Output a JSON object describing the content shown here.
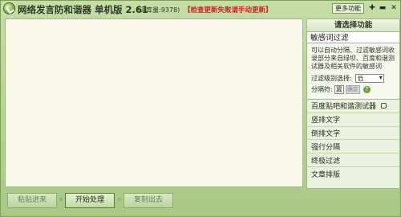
{
  "window": {
    "title": "网络发言防和谐器 单机版 2.61",
    "word_count": "(词库量:9378)",
    "update_link": "【检查更新失败请手动更新】",
    "more_button": "更多功能",
    "controls": {
      "pin": "✚",
      "minimize": "▬",
      "close": "✕"
    }
  },
  "editor": {
    "value": ""
  },
  "panel": {
    "header": "请选择功能",
    "selected": "敏感词过滤",
    "description": "可以自动分隔、过滤敏感词收录部分来自绿坝、百度和谐测试器及相关软件的敏感词",
    "level_label": "过滤级别选择:",
    "level_value": "低",
    "separator_label": "分隔符:",
    "separator_value": "冀",
    "confirm_label": "确定",
    "help_glyph": "?",
    "items": [
      {
        "label": "百度贴吧和谐测试器"
      },
      {
        "label": "竖排文字"
      },
      {
        "label": "倒排文字"
      },
      {
        "label": "强行分隔"
      },
      {
        "label": "终极过滤"
      },
      {
        "label": "文章排版"
      }
    ]
  },
  "buttons": {
    "paste": "粘贴进来",
    "start": "开始处理",
    "copy": "复制出去",
    "chevron": "»"
  },
  "colors": {
    "background": "#b9d39a",
    "editor_bg": "#fbf9ec",
    "update_link": "#d31c1c",
    "panel_bg": "#eaf2df"
  }
}
